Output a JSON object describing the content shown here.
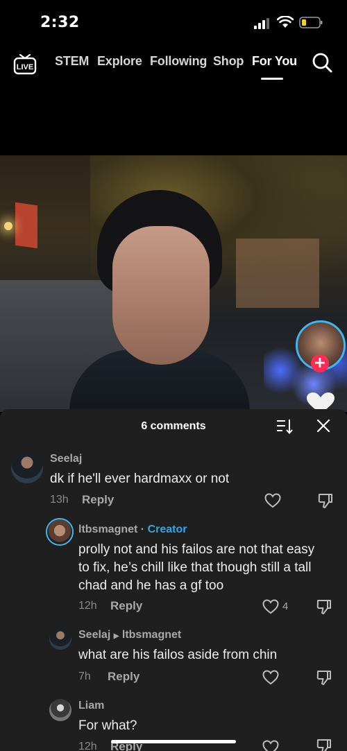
{
  "status": {
    "time": "2:32"
  },
  "nav": {
    "tabs": [
      "STEM",
      "Explore",
      "Following",
      "Shop",
      "For You"
    ],
    "active_tab": "For You"
  },
  "comments": {
    "title": "6 comments",
    "items": [
      {
        "author": "Seelaj",
        "text": "dk if he'll ever hardmaxx or not",
        "time": "13h",
        "reply_label": "Reply"
      },
      {
        "author": "ltbsmagnet",
        "badge": "Creator",
        "text_lines": [
          "prolly not and his failos are not that easy",
          "to fix, he’s chill like that though still a tall",
          "chad and he has a gf too"
        ],
        "time": "12h",
        "reply_label": "Reply",
        "likes": "4"
      },
      {
        "author": "Seelaj",
        "reply_to": "ltbsmagnet",
        "text": "what are his failos aside from chin",
        "time": "7h",
        "reply_label": "Reply"
      },
      {
        "author": "Liam",
        "text": "For what?",
        "time": "12h",
        "reply_label": "Reply"
      }
    ]
  },
  "colors": {
    "accent_creator": "#2fa6e8",
    "follow_red": "#fe2c55",
    "sheet_bg": "#1f1f1f"
  },
  "icons": [
    "live-icon",
    "search-icon",
    "sort-icon",
    "close-icon",
    "heart-icon",
    "dislike-icon",
    "plus-icon"
  ]
}
